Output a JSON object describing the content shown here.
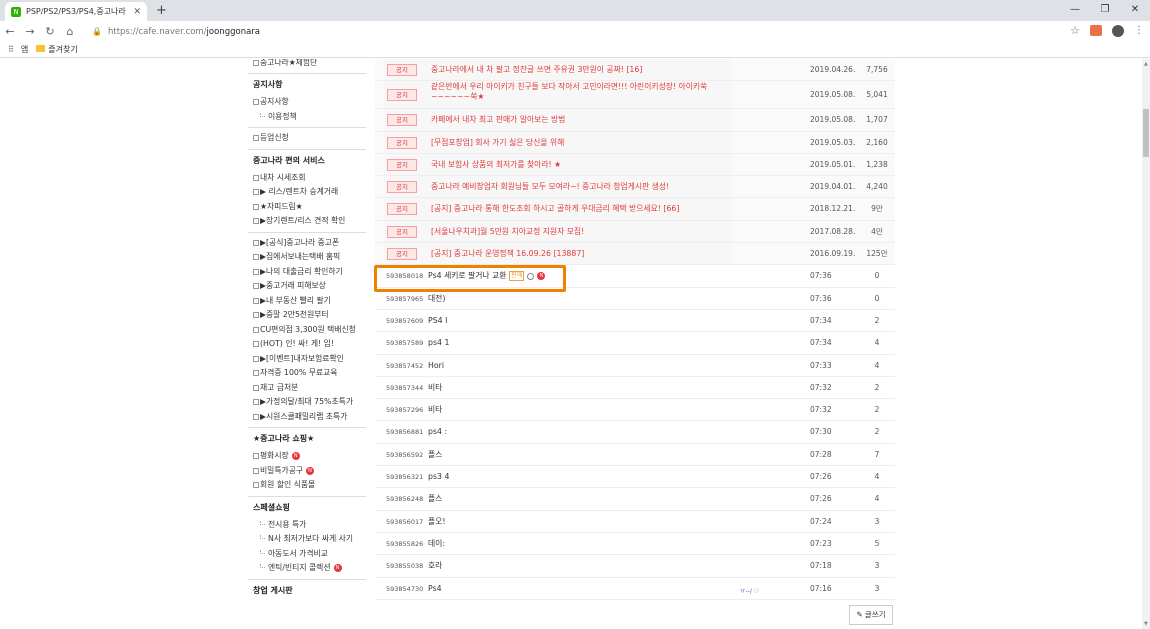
{
  "browser": {
    "tab_title": "PSP/PS2/PS3/PS4,중고나라 : 네",
    "tab_favicon": "N",
    "url_host": "https://cafe.naver.com/",
    "url_path": "joonggonara",
    "bookmarks": [
      "앱",
      "즐겨찾기"
    ]
  },
  "sidebar": {
    "top_item": "중고나라★체험단",
    "sections": [
      {
        "title": "공지사항",
        "items": [
          {
            "label": "공지사항",
            "icon": "board-icon"
          },
          {
            "label": "이용정책",
            "icon": "tree-icon"
          }
        ]
      },
      {
        "title": "",
        "items": [
          {
            "label": "등업신청",
            "icon": "board-icon"
          }
        ]
      },
      {
        "title": "중고나라 편의 서비스",
        "items": [
          {
            "label": "내차 시세조회",
            "icon": "board-icon"
          },
          {
            "label": "▶ 리스/렌트차 승계거래",
            "icon": "board-icon"
          },
          {
            "label": "★자피드림★",
            "icon": "board-icon"
          },
          {
            "label": "▶장기렌트/리스 견적 확인",
            "icon": "board-icon"
          }
        ]
      },
      {
        "title": "",
        "items": [
          {
            "label": "▶[공식]중고나라 중고폰",
            "icon": "board-icon"
          },
          {
            "label": "▶집에서보내는택배 홈픽",
            "icon": "board-icon"
          },
          {
            "label": "▶나의 대출금리 확인하기",
            "icon": "board-icon"
          },
          {
            "label": "▶중고거래 피해보상",
            "icon": "board-icon"
          },
          {
            "label": "▶내 부동산 빨리 팔기",
            "icon": "board-icon"
          },
          {
            "label": "▶중말 2만5천원부터",
            "icon": "board-icon"
          },
          {
            "label": "CU편의점 3,300원 택배신청",
            "icon": "board-icon"
          },
          {
            "label": "(HOT) 인! 싸! 게! 임!",
            "icon": "board-icon"
          },
          {
            "label": "▶[이벤트]내자보험료확인",
            "icon": "board-icon"
          },
          {
            "label": "자격증 100% 무료교육",
            "icon": "board-icon"
          },
          {
            "label": "재고 급처분",
            "icon": "board-icon"
          },
          {
            "label": "▶가정의달/최대 75%초특가",
            "icon": "board-icon"
          },
          {
            "label": "▶시원스쿨패밀리랩 초특가",
            "icon": "board-icon"
          }
        ]
      },
      {
        "title": "★중고나라 쇼핑★",
        "items": [
          {
            "label": "평화시장",
            "icon": "board-icon",
            "new": true
          },
          {
            "label": "비밀특가공구",
            "icon": "board-icon",
            "new": true
          },
          {
            "label": "회원 할인 식품몰",
            "icon": "board-icon"
          }
        ]
      },
      {
        "title": "스페셜쇼핑",
        "items": [
          {
            "label": "전시용 특가",
            "icon": "tree-icon"
          },
          {
            "label": "N사 최저가보다 싸게 사기",
            "icon": "tree-icon"
          },
          {
            "label": "아동도서 가격비교",
            "icon": "tree-icon"
          },
          {
            "label": "엔틱/빈티지 콜렉션",
            "icon": "tree-icon",
            "new": true
          }
        ]
      },
      {
        "title": "창업 게시판",
        "items": []
      }
    ],
    "new_badge": "N"
  },
  "board": {
    "notice_badge": "공지",
    "notices": [
      {
        "title": "중고나라에서 내 차 팔고 정찬글 쓰면 주유권 3만원이 공짜! [16]",
        "date": "2019.04.26.",
        "views": "7,756"
      },
      {
        "title": "같은반에서 우리 아이키가 친구들 보다 작아서 고민이라면!!! 아린이키성장! 아이키쑥~~~~~~쑥★",
        "date": "2019.05.08.",
        "views": "5,041",
        "two_line": true
      },
      {
        "title": "카페에서 내차 최고 판매가 알아보는 방법",
        "date": "2019.05.08.",
        "views": "1,707"
      },
      {
        "title": "[무점포창업] 회사 가기 싫은 당신을 위해",
        "date": "2019.05.03.",
        "views": "2,160"
      },
      {
        "title": "국내 보험사 상품의 최저가를 찾아라! ★",
        "date": "2019.05.01.",
        "views": "1,238"
      },
      {
        "title": "중고나라 예비창업자 회원님들 모두 모여라~! 중고나라 창업게시판 생성!",
        "date": "2019.04.01.",
        "views": "4,240"
      },
      {
        "title": "[공지] 중고나라 통해 한도조회 하시고 골하게 우대금리 혜택 받으세요! [66]",
        "date": "2018.12.21.",
        "views": "9만"
      },
      {
        "title": "[서울나우치과]월 5만원 치아교정 지원자 모집!",
        "date": "2017.08.28.",
        "views": "4만"
      },
      {
        "title": "[공지] 중고나라 운영정책 16.09.26 [13887]",
        "date": "2016.09.19.",
        "views": "125만"
      }
    ],
    "posts": [
      {
        "num": "593858018",
        "title": "Ps4 세키로 팔거나 교환",
        "tag": "판매",
        "time": "07:36",
        "views": "0"
      },
      {
        "num": "593857965",
        "title": "대전)",
        "time": "07:36",
        "views": "0"
      },
      {
        "num": "593857609",
        "title": "PS4 I",
        "time": "07:34",
        "views": "2"
      },
      {
        "num": "593857589",
        "title": "ps4 1",
        "time": "07:34",
        "views": "4"
      },
      {
        "num": "593857452",
        "title": "Hori",
        "time": "07:33",
        "views": "4"
      },
      {
        "num": "593857344",
        "title": "비타",
        "time": "07:32",
        "views": "2"
      },
      {
        "num": "593857296",
        "title": "비타",
        "time": "07:32",
        "views": "2"
      },
      {
        "num": "593856881",
        "title": "ps4 :",
        "time": "07:30",
        "views": "2"
      },
      {
        "num": "593856592",
        "title": "플스",
        "time": "07:28",
        "views": "7"
      },
      {
        "num": "593856321",
        "title": "ps3 4",
        "time": "07:26",
        "views": "4"
      },
      {
        "num": "593856248",
        "title": "플스",
        "time": "07:26",
        "views": "4"
      },
      {
        "num": "593856017",
        "title": "플오!",
        "time": "07:24",
        "views": "3"
      },
      {
        "num": "593855826",
        "title": "데이:",
        "time": "07:23",
        "views": "5"
      },
      {
        "num": "593855038",
        "title": "호라",
        "time": "07:18",
        "views": "3"
      },
      {
        "num": "593854730",
        "title": "Ps4",
        "time": "07:16",
        "views": "3"
      }
    ],
    "write_button": "글쓰기",
    "stray_text": "ㅠ--/ ♡"
  },
  "colors": {
    "accent_orange": "#f08000",
    "notice_red": "#e03a3a",
    "naver_green": "#2db400"
  }
}
